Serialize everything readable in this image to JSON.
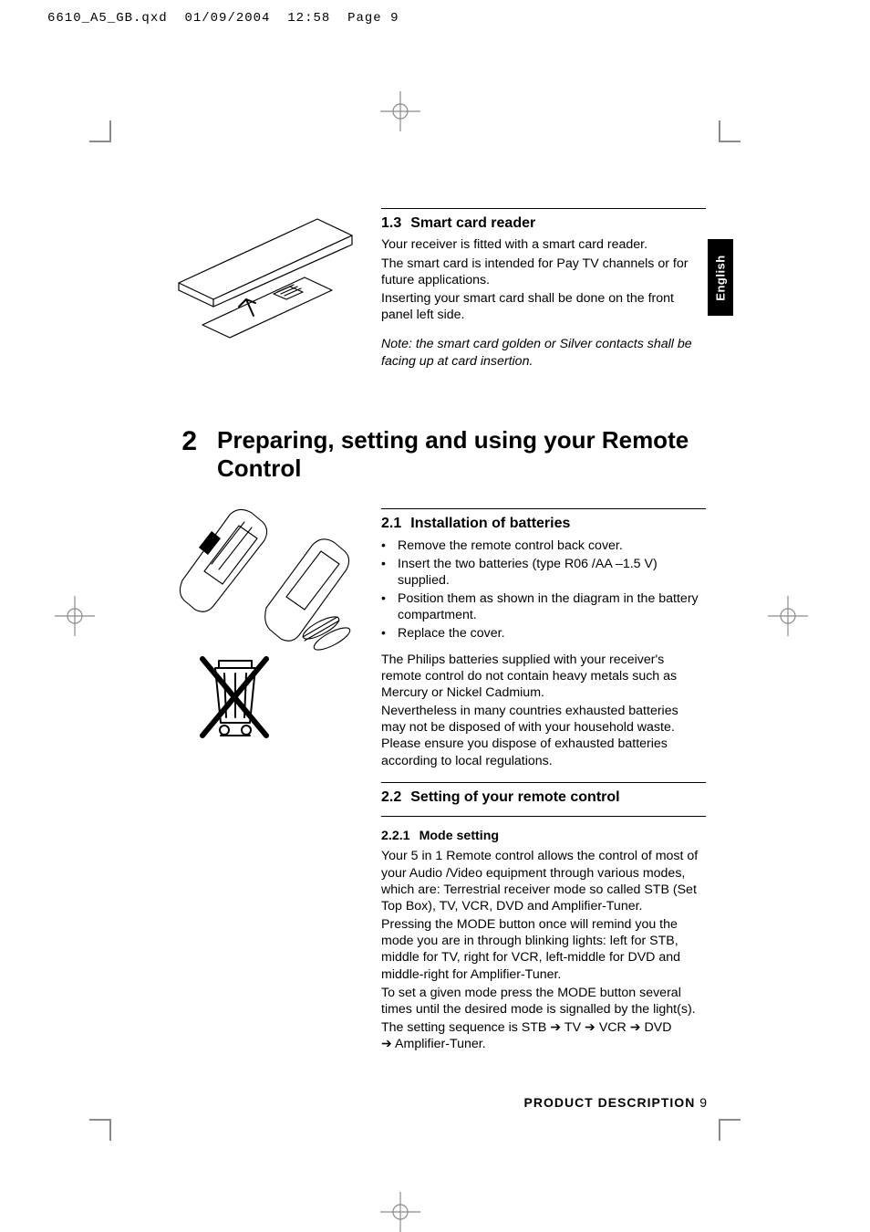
{
  "header": {
    "file": "6610_A5_GB.qxd",
    "date": "01/09/2004",
    "time": "12:58",
    "page_word": "Page",
    "page_num": "9"
  },
  "lang_tab": "English",
  "section1": {
    "num": "1.3",
    "title": "Smart card reader",
    "p1": "Your receiver is fitted with a smart card reader.",
    "p2": "The smart card is intended for Pay TV channels or for future applications.",
    "p3": "Inserting your smart card shall be done on the front panel left side.",
    "note": "Note: the smart card golden or Silver contacts shall be facing up at card insertion."
  },
  "chapter2": {
    "num": "2",
    "title": "Preparing, setting and using your Remote Control"
  },
  "section21": {
    "num": "2.1",
    "title": "Installation of batteries",
    "b1": "Remove the remote control back cover.",
    "b2": "Insert the two batteries (type R06 /AA –1.5 V) supplied.",
    "b3": "Position them as shown in the diagram in the battery compartment.",
    "b4": "Replace the cover.",
    "p1": "The Philips batteries supplied with your receiver's remote control do not contain heavy metals such as Mercury or Nickel Cadmium.",
    "p2": "Nevertheless in many countries exhausted batteries may not be disposed of with your household waste. Please ensure you dispose of exhausted batteries according to local regulations."
  },
  "section22": {
    "num": "2.2",
    "title": "Setting of your remote control"
  },
  "section221": {
    "num": "2.2.1",
    "title": "Mode setting",
    "p1": "Your 5 in 1 Remote control allows the control of most of your Audio /Video equipment through various modes, which are: Terrestrial receiver mode so called STB (Set Top Box), TV, VCR, DVD and Amplifier-Tuner.",
    "p2": "Pressing the MODE button once will remind you the mode you are in through blinking lights: left for STB, middle for TV, right for VCR, left-middle for DVD and middle-right for Amplifier-Tuner.",
    "p3": "To set a given mode press the MODE button several times until the desired mode is signalled by the light(s).",
    "p4a": "The setting sequence is STB ",
    "p4b": " TV ",
    "p4c": " VCR ",
    "p4d": " DVD ",
    "p4e": " Amplifier-Tuner.",
    "arrow": "➔"
  },
  "footer": {
    "label": "PRODUCT DESCRIPTION",
    "page": "9"
  }
}
